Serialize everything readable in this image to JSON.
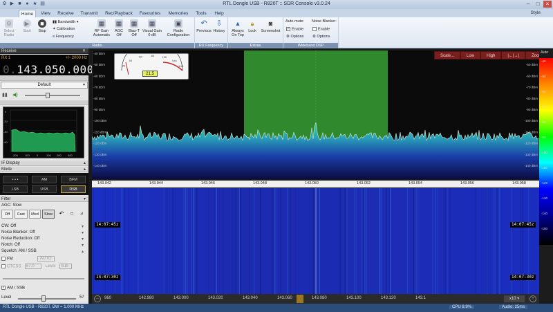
{
  "app": {
    "title": "RTL Dongle USB - R820T :: SDR Console v3.0.24",
    "style_label": "Style"
  },
  "tabs": [
    "Home",
    "View",
    "Receive",
    "Transmit",
    "Rec/Playback",
    "Favourites",
    "Memories",
    "Tools",
    "Help"
  ],
  "ribbon": {
    "radio": {
      "label": "Radio",
      "select": "Select\nRadio",
      "start": "Start",
      "stop": "Stop",
      "bandwidth": "Bandwidth",
      "calibration": "Calibration",
      "frequency": "Frequency",
      "rfgain": "RF Gain\nAutomatic",
      "agc": "AGC\nOff",
      "biast": "Bias-T\nOff",
      "visual": "Visual Gain\n0 dB",
      "config": "Radio\nConfiguration"
    },
    "rxfreq": {
      "label": "RX Frequency",
      "previous": "Previous",
      "history": "History"
    },
    "extras": {
      "label": "Extras",
      "always": "Always\nOn Top",
      "lock": "Lock",
      "screenshot": "Screenshot"
    },
    "wbdsp": {
      "label": "Wideband DSP",
      "automute": "Auto-mute:",
      "noiseblanker": "Noise Blanker:",
      "enable": "Enable",
      "options": "Options"
    }
  },
  "left": {
    "receive": "Receive",
    "rx": "RX 1",
    "step": "+/- 2000 Hz",
    "freq_dim": "0.",
    "freq": "143.050.000",
    "preset": "Default",
    "ifdisplay": "IF Display",
    "ifticks_y": [
      "0",
      "-20",
      "-40",
      "-60"
    ],
    "ifticks_x": [
      "200",
      "100",
      "0",
      "100",
      "200",
      "300"
    ],
    "mode": "Mode",
    "modes": [
      "• • •",
      "AM",
      "BFM",
      "LSB",
      "USB",
      "DSB"
    ],
    "filter": "Filter",
    "agc": "AGC: Slow",
    "agcbtns": [
      "Off",
      "Fast",
      "Med",
      "Slow"
    ],
    "cw": "CW: Off",
    "nb": "Noise Blanker: Off",
    "nr": "Noise Reduction: Off",
    "notch": "Notch: Off",
    "squelch": "Squelch: AM / SSB",
    "fm": "FM",
    "auto": "AUTO",
    "ctcss": "CTCSS",
    "ctcss_val": "67.0",
    "level": "Level",
    "level_val": "Sub",
    "am_ssb": "AM / SSB",
    "levelnum": "57"
  },
  "spectrum": {
    "dbm_left": [
      "-40 dBm",
      "-50 dBm",
      "-60 dBm",
      "-70 dBm",
      "-80 dBm",
      "-90 dBm",
      "-100 dBm",
      "-110 dBm",
      "-120 dBm",
      "-130 dBm",
      "-140 dBm"
    ],
    "dbm_right": [
      "-40 dBm",
      "-50 dBm",
      "-60 dBm",
      "-70 dBm",
      "-80 dBm",
      "-90 dBm",
      "-100 dBm",
      "-110 dBm",
      "-120 dBm",
      "-130 dBm",
      "-140 dBm"
    ],
    "buttons": [
      "Scale...",
      "Low",
      "High",
      "|←|→|",
      "Zoom"
    ],
    "freq_axis": [
      "143.042",
      "143.044",
      "143.046",
      "143.048",
      "143.050",
      "143.052",
      "143.054",
      "143.056",
      "143.058"
    ],
    "meter_scale": [
      "20",
      "40",
      "60",
      "80",
      "100",
      "120",
      "140"
    ],
    "meter_value": "21.5"
  },
  "waterfall": {
    "times": [
      "14:07:45z",
      "14:07:30z"
    ],
    "bottom_axis": [
      "960",
      "142.980",
      "143.000",
      "143.020",
      "143.040",
      "143.060",
      "143.080",
      "143.100",
      "143.120",
      "143.1"
    ],
    "zoom": "x10"
  },
  "scale_ticks": [
    "-40",
    "-50",
    "-60",
    "-70",
    "-80",
    "-90",
    "-100",
    "-110",
    "-120",
    "-130",
    "-140",
    "-150"
  ],
  "right_label": "Auto",
  "status": {
    "left": "RTL Dongle USB - R820T, BW = 1.000 MHz",
    "cpu": "CPU 8.9%",
    "audio": "Audio: 25ms"
  },
  "colors": {
    "accent": "#c9a443",
    "spectrum_fill": "#2bb0c8",
    "selection": "#3fb43a",
    "waterfall": "#1b2bb8"
  }
}
